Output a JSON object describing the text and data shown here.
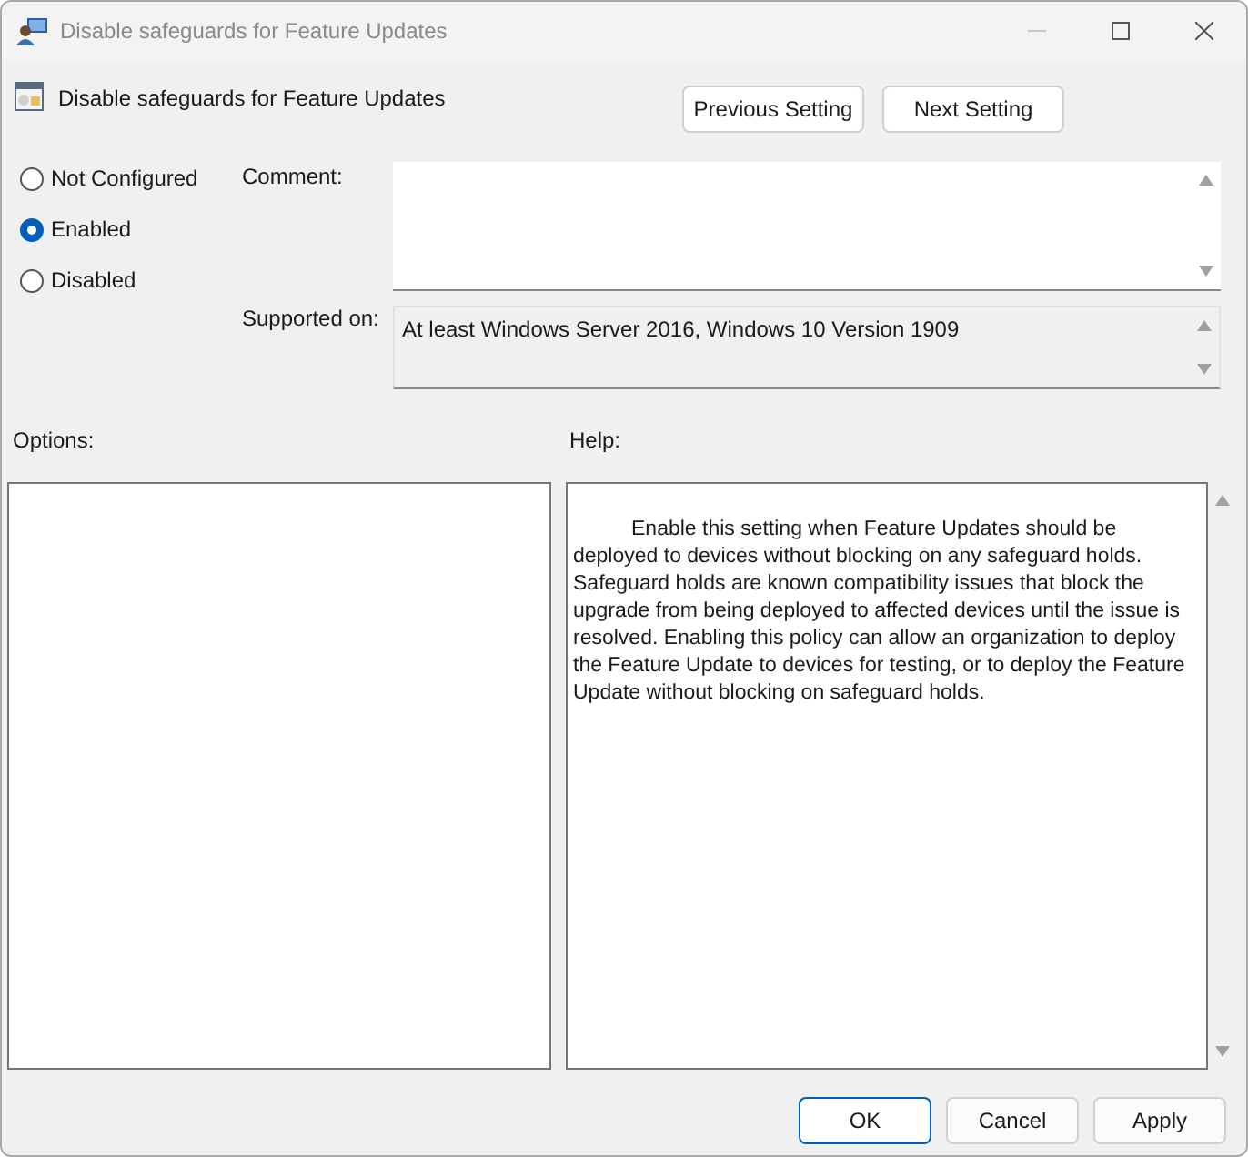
{
  "window": {
    "title": "Disable safeguards for Feature Updates"
  },
  "header": {
    "title": "Disable safeguards for Feature Updates",
    "buttons": [
      "Previous Setting",
      "Next Setting"
    ]
  },
  "states": [
    {
      "label": "Not Configured",
      "selected": false
    },
    {
      "label": "Enabled",
      "selected": true
    },
    {
      "label": "Disabled",
      "selected": false
    }
  ],
  "comment": {
    "label": "Comment:"
  },
  "supported_on": {
    "label": "Supported on:",
    "value": "At least Windows Server 2016, Windows 10 Version 1909"
  },
  "options": {
    "label": "Options:"
  },
  "help": {
    "label": "Help:",
    "text": "Enable this setting when Feature Updates should be deployed to devices without blocking on any safeguard holds. Safeguard holds are known compatibility issues that block the upgrade from being deployed to affected devices until the issue is resolved. Enabling this policy can allow an organization to deploy the Feature Update to devices for testing, or to deploy the Feature Update without blocking on safeguard holds."
  },
  "buttons": [
    {
      "label": "OK",
      "kind": "default"
    },
    {
      "label": "Cancel",
      "kind": "normal"
    },
    {
      "label": "Apply",
      "kind": "normal"
    }
  ]
}
